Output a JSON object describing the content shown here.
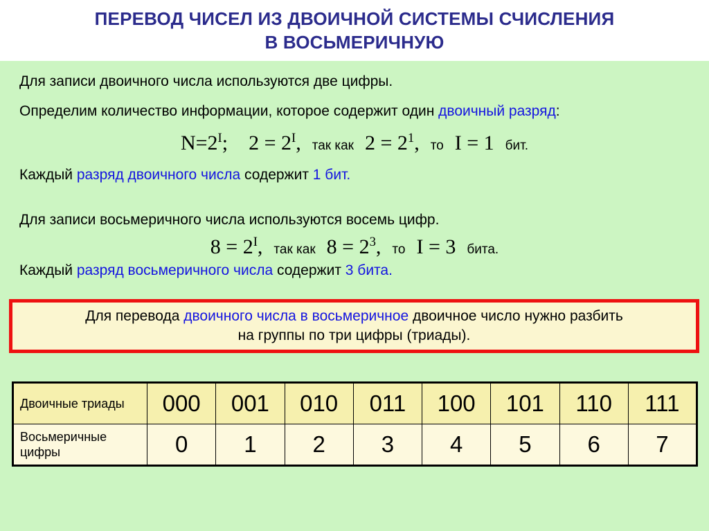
{
  "slide": {
    "title": "ПЕРЕВОД ЧИСЕЛ ИЗ ДВОИЧНОЙ СИСТЕМЫ СЧИСЛЕНИЯ В ВОСЬМЕРИЧНУЮ",
    "title_line1": "ПЕРЕВОД ЧИСЕЛ ИЗ ДВОИЧНОЙ СИСТЕМЫ СЧИСЛЕНИЯ",
    "title_line2": "В ВОСЬМЕРИЧНУЮ",
    "background_color": "#ccf5c2",
    "title_color": "#2b2b8c",
    "highlight_color": "#1414e0",
    "callout_border_color": "#ee1111",
    "callout_background_color": "#fbf6d0"
  },
  "binary_section": {
    "line1": "Для записи двоичного числа используются две цифры.",
    "line2_a": "Определим количество информации, которое содержит один ",
    "line2_highlight": "двоичный разряд",
    "line2_b": ":",
    "formula": {
      "lhs": "N=2",
      "lhs_exp": "I",
      "lhs_end": ";",
      "eq1_left": "2 = 2",
      "eq1_exp": "I",
      "eq1_end": ",",
      "connector": "так как",
      "eq2_left": "2 = 2",
      "eq2_exp": "1",
      "eq2_end": ",",
      "then": "то",
      "result": "I = 1",
      "unit": "бит."
    },
    "conclusion_a": "Каждый ",
    "conclusion_highlight": "разряд двоичного числа",
    "conclusion_b": " содержит ",
    "conclusion_value": "1 бит.",
    "conclusion_value_color": "#1414e0"
  },
  "octal_section": {
    "line1": "Для записи восьмеричного числа используются восемь цифр.",
    "formula": {
      "eq1_left": "8 = 2",
      "eq1_exp": "I",
      "eq1_end": ",",
      "connector": "так как",
      "eq2_left": "8 = 2",
      "eq2_exp": "3",
      "eq2_end": ",",
      "then": "то",
      "result": "I = 3",
      "unit": "бита."
    },
    "conclusion_a": "Каждый ",
    "conclusion_highlight": "разряд восьмеричного числа",
    "conclusion_b": " содержит ",
    "conclusion_value": "3 бита.",
    "conclusion_value_color": "#1414e0"
  },
  "callout": {
    "line1_a": "Для перевода ",
    "line1_highlight": "двоичного числа в восьмеричное",
    "line1_b": " двоичное число нужно разбить",
    "line2": "на группы по три цифры (триады)."
  },
  "table": {
    "row_labels": [
      "Двоичные триады",
      "Восьмеричные цифры"
    ],
    "binary_triads": [
      "000",
      "001",
      "010",
      "011",
      "100",
      "101",
      "110",
      "111"
    ],
    "octal_digits": [
      "0",
      "1",
      "2",
      "3",
      "4",
      "5",
      "6",
      "7"
    ]
  }
}
